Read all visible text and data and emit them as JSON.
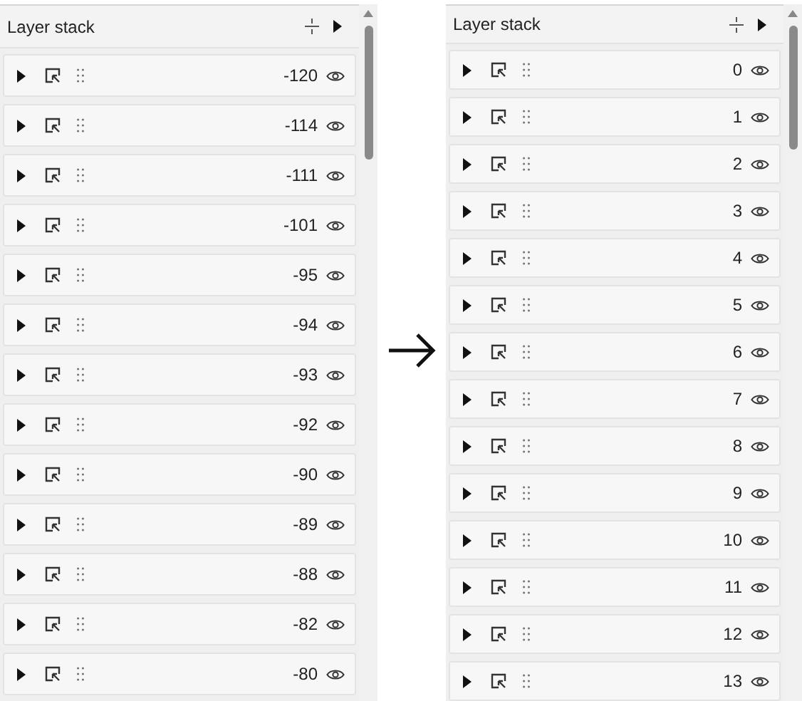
{
  "panels": [
    {
      "title": "Layer stack",
      "rows": [
        "-120",
        "-114",
        "-111",
        "-101",
        "-95",
        "-94",
        "-93",
        "-92",
        "-90",
        "-89",
        "-88",
        "-82",
        "-80"
      ]
    },
    {
      "title": "Layer stack",
      "rows": [
        "0",
        "1",
        "2",
        "3",
        "4",
        "5",
        "6",
        "7",
        "8",
        "9",
        "10",
        "11",
        "12",
        "13"
      ]
    }
  ]
}
